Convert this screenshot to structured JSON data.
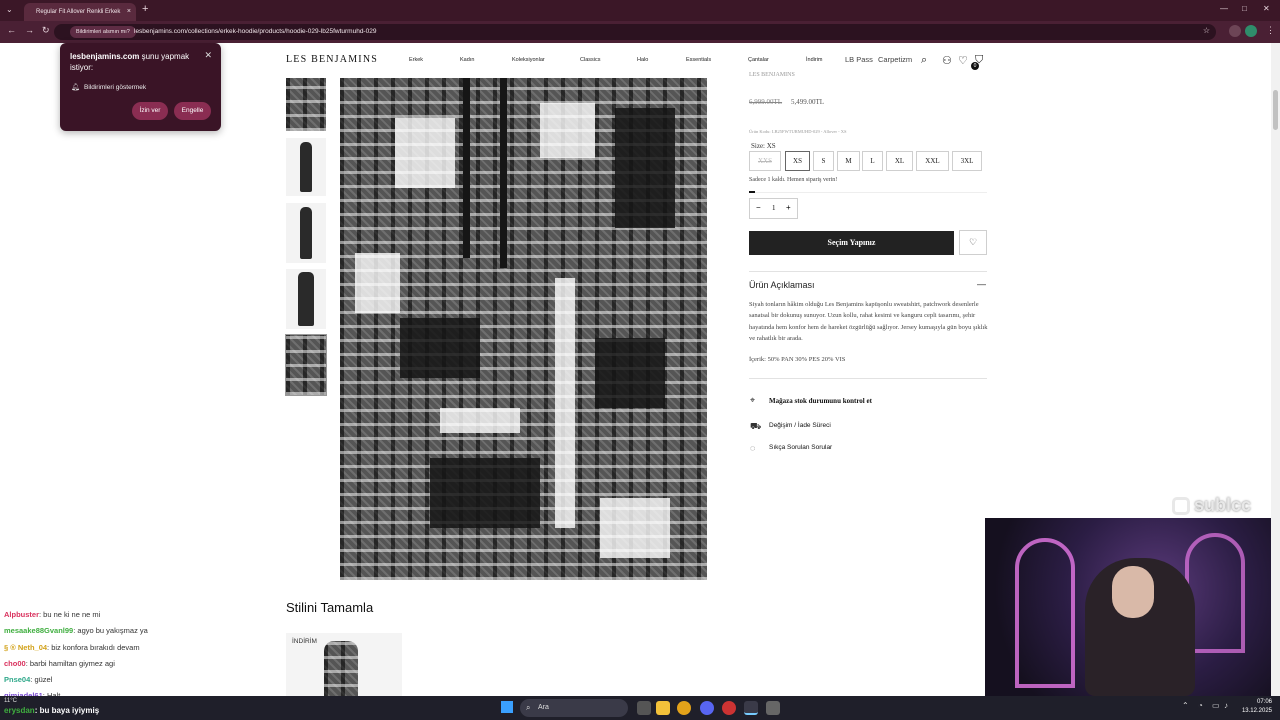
{
  "browser": {
    "tab_title": "Regular Fit Allover Renkli Erkek",
    "tab_close": "×",
    "new_tab": "+",
    "permission_chip": "Bildirimleri alsmın mı?",
    "url": "lesbenjamins.com/collections/erkek-hoodie/products/hoodie-029-lb25fwturmuhd-029"
  },
  "popup": {
    "site": "lesbenjamins.com",
    "title_rest": " şunu yapmak istiyor:",
    "permission": "Bildirimleri göstermek",
    "allow": "İzin ver",
    "block": "Engelle"
  },
  "site": {
    "logo": "LES BENJAMINS",
    "nav": [
      "Erkek",
      "Kadın",
      "Koleksiyonlar",
      "Classics",
      "Halo",
      "Essentials",
      "Çantalar",
      "İndirim"
    ],
    "links": [
      "LB Pass",
      "Carpetizm"
    ],
    "cart_count": "0"
  },
  "product": {
    "brand_cut": "LES BENJAMINS",
    "old_price": "6,999.00TL",
    "new_price": "5,499.00TL",
    "sku": "Ürün Kodu: LB25FWTURMUHD-029 - Allover - XS",
    "size_label": "Size: XS",
    "sizes": [
      "XXS",
      "XS",
      "S",
      "M",
      "L",
      "XL",
      "XXL",
      "3XL"
    ],
    "stock_note": "Sadece 1 kaldı. Hemen sipariş verin!",
    "qty": "1",
    "qty_minus": "−",
    "qty_plus": "+",
    "add_button": "Seçim Yapınız",
    "desc_title": "Ürün Açıklaması",
    "desc_toggle": "—",
    "description": "Siyah tonların hâkim olduğu Les Benjamins kapüşonlu sweatshirt, patchwork desenlerle sanatsal bir dokunuş sunuyor. Uzun kollu, rahat kesimi ve kanguru cepli tasarımı, şehir hayatında hem konfor hem de hareket özgürlüğü sağlıyor. Jersey kumaşıyla gün boyu şıklık ve rahatlık bir arada.",
    "content": "İçerik: 50% PAN 30% PES 20% VIS",
    "store_stock": "Mağaza stok durumunu kontrol et",
    "returns": "Değişim / İade Süreci",
    "faq": "Sıkça Sorulan Sorular"
  },
  "style_section": {
    "heading": "Stilini Tamamla",
    "badge": "İNDİRİM"
  },
  "stream": {
    "insta": "sublcc",
    "chat": [
      {
        "user": "Alpbuster",
        "msg": ": bu ne ki ne ne mi",
        "color": "#d9325e"
      },
      {
        "user": "mesaake88Gvanl99",
        "msg": ": agyo bu yakışmaz ya",
        "color": "#3fae3f"
      },
      {
        "user": "§ ® Neth_04",
        "msg": ": biz konfora bırakıdı devam",
        "color": "#d2a21a"
      },
      {
        "user": "cho00",
        "msg": ": barbi hamiltan giymez agi",
        "color": "#d9325e"
      },
      {
        "user": "Pnse04",
        "msg": ": güzel",
        "color": "#2fa88a"
      },
      {
        "user": "gimjadel61",
        "msg": ": Halt",
        "color": "#7a4bd1"
      }
    ]
  },
  "taskbar": {
    "weather": "11°C",
    "chat_overlay_user": "erysdan",
    "chat_overlay_msg": ": bu baya iyiymiş",
    "search": "Ara",
    "time": "07:06",
    "date": "13.12.2025"
  }
}
